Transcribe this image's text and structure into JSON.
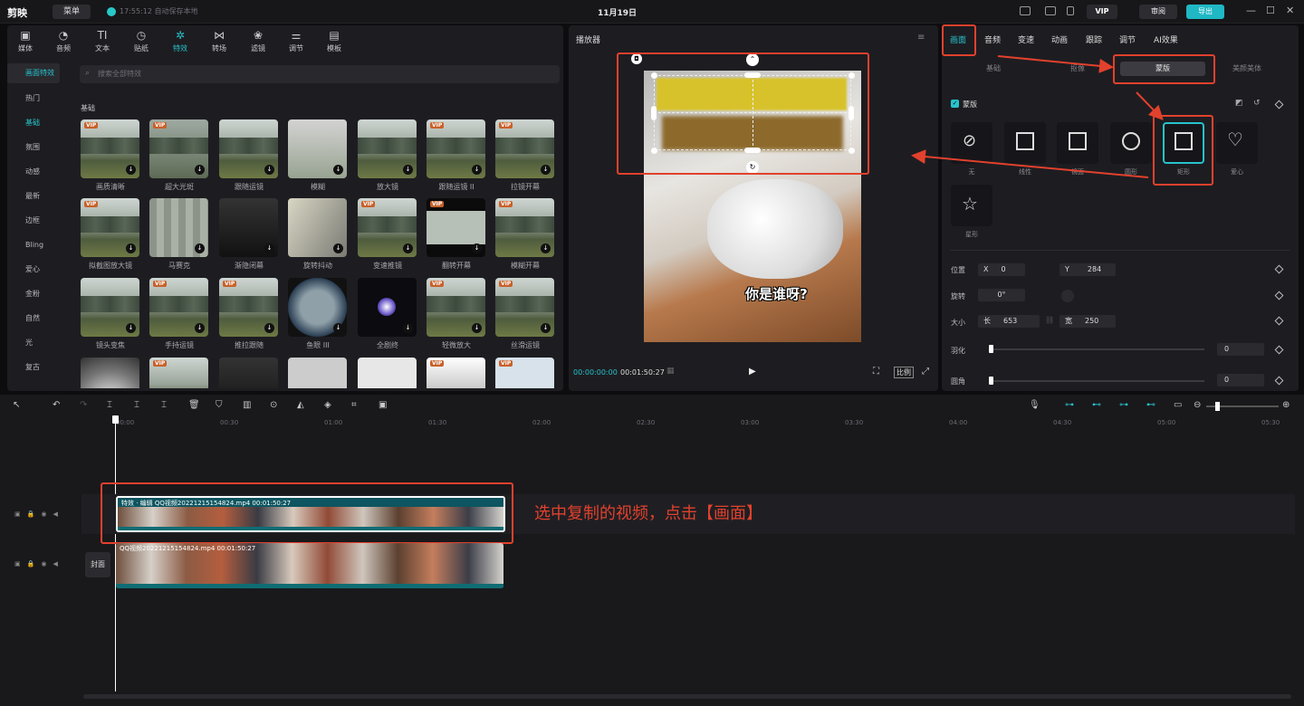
{
  "titlebar": {
    "logo": "剪映",
    "menu": "菜单",
    "save_status": "17:55:12 自动保存本地",
    "doc_title": "11月19日",
    "vip": "VIP",
    "review": "审阅",
    "export": "导出"
  },
  "media_tabs": [
    {
      "label": "媒体",
      "icon": "media-icon"
    },
    {
      "label": "音频",
      "icon": "audio-icon"
    },
    {
      "label": "文本",
      "icon": "text-icon"
    },
    {
      "label": "贴纸",
      "icon": "sticker-icon"
    },
    {
      "label": "特效",
      "icon": "effects-icon"
    },
    {
      "label": "转场",
      "icon": "transition-icon"
    },
    {
      "label": "滤镜",
      "icon": "filter-icon"
    },
    {
      "label": "调节",
      "icon": "adjust-icon"
    },
    {
      "label": "模板",
      "icon": "template-icon"
    }
  ],
  "sidebar": {
    "header": "画面特效",
    "items": [
      "热门",
      "基础",
      "氛围",
      "动感",
      "最新",
      "边框",
      "Bling",
      "爱心",
      "金粉",
      "自然",
      "光",
      "复古"
    ]
  },
  "search": {
    "placeholder": "搜索全部特效"
  },
  "section_label": "基础",
  "effects": [
    "画质清晰",
    "超大光斑",
    "跟随运镜",
    "模糊",
    "放大镜",
    "跟随运镜 II",
    "拉镜开幕",
    "拟截图放大镜",
    "马赛克",
    "渐隐闭幕",
    "旋转抖动",
    "变速推镜",
    "翻转开幕",
    "模糊开幕",
    "镜头变焦",
    "手持运镜",
    "推拉跟随",
    "鱼眼 III",
    "全剧终",
    "轻微放大",
    "丝滑运镜"
  ],
  "player": {
    "title": "播放器",
    "caption": "你是谁呀?",
    "time_current": "00:00:00:00",
    "time_total": "00:01:50:27",
    "ratio_label": "比例"
  },
  "props": {
    "tabs": [
      "画面",
      "音频",
      "变速",
      "动画",
      "跟踪",
      "调节",
      "AI效果"
    ],
    "sub_tabs": [
      "基础",
      "抠像",
      "蒙版",
      "美颜美体"
    ],
    "mask_section": "蒙版",
    "masks": [
      {
        "label": "无",
        "icon": "none-icon"
      },
      {
        "label": "线性",
        "icon": "linear-mask-icon"
      },
      {
        "label": "镜面",
        "icon": "mirror-mask-icon"
      },
      {
        "label": "圆形",
        "icon": "circle-mask-icon"
      },
      {
        "label": "矩形",
        "icon": "rectangle-mask-icon"
      },
      {
        "label": "爱心",
        "icon": "heart-mask-icon"
      },
      {
        "label": "星形",
        "icon": "star-mask-icon"
      }
    ],
    "position_label": "位置",
    "x_label": "X",
    "x_value": "0",
    "y_label": "Y",
    "y_value": "284",
    "rotate_label": "旋转",
    "rotate_value": "0°",
    "size_label": "大小",
    "length_label": "长",
    "length_value": "653",
    "width_label": "宽",
    "width_value": "250",
    "feather_label": "羽化",
    "feather_value": "0",
    "radius_label": "圆角",
    "radius_value": "0"
  },
  "timeline": {
    "ticks": [
      "00:00",
      "00:30",
      "01:00",
      "01:30",
      "02:00",
      "02:30",
      "03:00",
      "03:30",
      "04:00",
      "04:30",
      "05:00",
      "05:30"
    ],
    "clip1_label": "特效 · 编辑  QQ视频20221215154824.mp4  00:01:50:27",
    "clip2_label": "QQ视频20221215154824.mp4  00:01:50:27",
    "cover": "封面"
  },
  "annotation": "选中复制的视频，点击【画面】",
  "colors": {
    "accent": "#27c2cc",
    "annotation_red": "#e2412d"
  }
}
